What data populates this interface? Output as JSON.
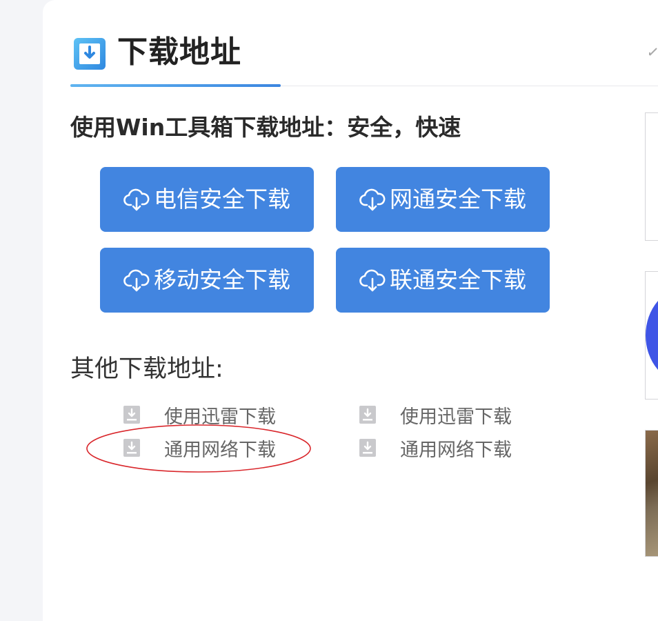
{
  "header": {
    "title": "下载地址",
    "icon": "download-box-icon",
    "accent_color": "#4285e0"
  },
  "subtitle": "使用Win工具箱下载地址：安全，快速",
  "download_buttons": [
    {
      "label": "电信安全下载",
      "icon": "cloud-download-icon"
    },
    {
      "label": "网通安全下载",
      "icon": "cloud-download-icon"
    },
    {
      "label": "移动安全下载",
      "icon": "cloud-download-icon"
    },
    {
      "label": "联通安全下载",
      "icon": "cloud-download-icon"
    }
  ],
  "button_color": "#4285e0",
  "other_section": {
    "title": "其他下载地址:",
    "links": [
      {
        "label": "使用迅雷下载",
        "icon": "file-download-icon"
      },
      {
        "label": "使用迅雷下载",
        "icon": "file-download-icon"
      },
      {
        "label": "通用网络下载",
        "icon": "file-download-icon"
      },
      {
        "label": "通用网络下载",
        "icon": "file-download-icon"
      }
    ]
  },
  "annotation": {
    "type": "red-oval-highlight",
    "target": "通用网络下载",
    "color": "#d9262b"
  }
}
